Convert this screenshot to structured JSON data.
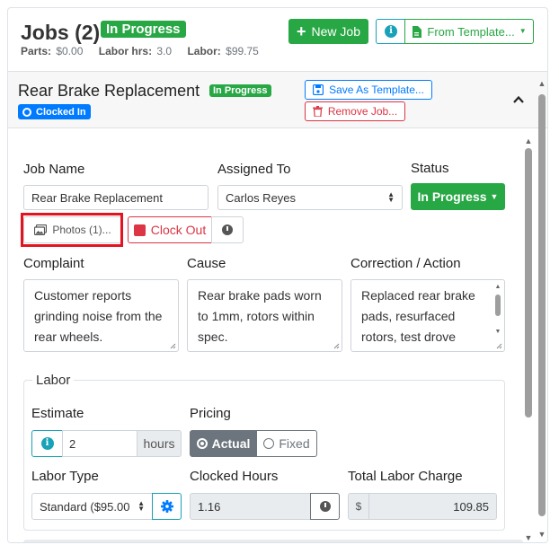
{
  "header": {
    "title": "Jobs (2)",
    "status_badge": "In Progress",
    "parts_label": "Parts:",
    "parts_value": "$0.00",
    "labor_hrs_label": "Labor hrs:",
    "labor_hrs_value": "3.0",
    "labor_label": "Labor:",
    "labor_value": "$99.75",
    "new_job_label": "New Job",
    "from_template_label": "From Template..."
  },
  "job": {
    "title": "Rear Brake Replacement",
    "status_badge": "In Progress",
    "clocked_badge": "Clocked In",
    "save_template_label": "Save As Template...",
    "remove_label": "Remove Job..."
  },
  "form": {
    "job_name_label": "Job Name",
    "job_name_value": "Rear Brake Replacement",
    "assigned_label": "Assigned To",
    "assigned_value": "Carlos Reyes",
    "status_label": "Status",
    "status_value": "In Progress",
    "photos_label": "Photos (1)...",
    "clock_out_label": "Clock Out",
    "complaint_label": "Complaint",
    "complaint_value": "Customer reports grinding noise from the rear wheels.",
    "cause_label": "Cause",
    "cause_value": "Rear brake pads worn to 1mm, rotors within spec.",
    "correction_label": "Correction / Action",
    "correction_value": "Replaced rear brake pads, resurfaced rotors, test drove"
  },
  "labor": {
    "legend": "Labor",
    "estimate_label": "Estimate",
    "estimate_value": "2",
    "estimate_unit": "hours",
    "pricing_label": "Pricing",
    "pricing_actual": "Actual",
    "pricing_fixed": "Fixed",
    "labor_type_label": "Labor Type",
    "labor_type_value": "Standard ($95.00",
    "clocked_hours_label": "Clocked Hours",
    "clocked_hours_value": "1.16",
    "total_label": "Total Labor Charge",
    "currency": "$",
    "total_value": "109.85"
  },
  "colors": {
    "success": "#28a745",
    "primary": "#007bff",
    "danger": "#dc3545",
    "info": "#17a2b8",
    "highlight": "#e3131f"
  }
}
